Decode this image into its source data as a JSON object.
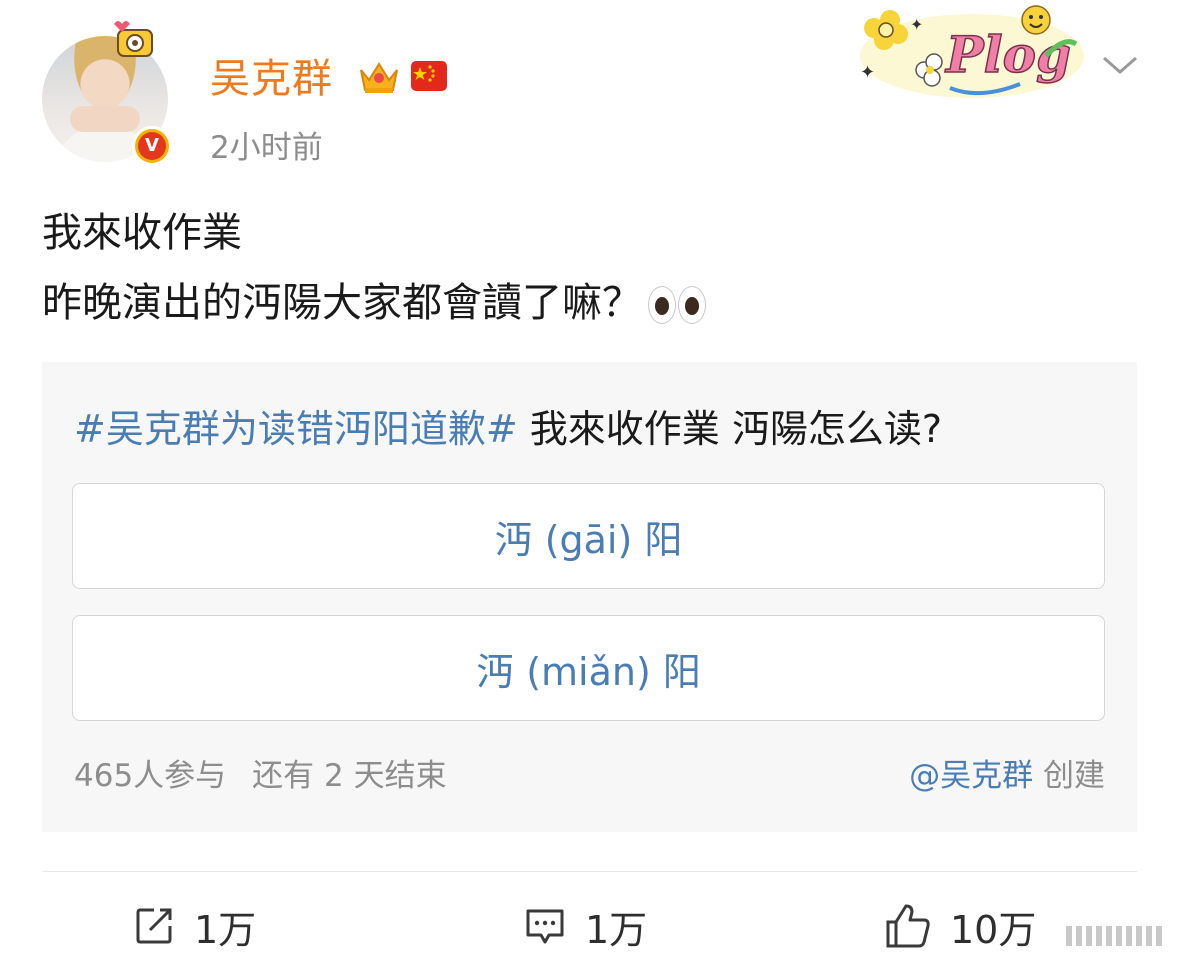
{
  "post": {
    "author": "吴克群",
    "timestamp": "2小时前",
    "lines": [
      "我來收作業",
      "昨晚演出的沔陽大家都會讀了嘛？"
    ],
    "sticker": "Plog"
  },
  "poll": {
    "topic": "#吴克群为读错沔阳道歉#",
    "question": " 我來收作業 沔陽怎么读?",
    "options": [
      "沔 (gāi) 阳",
      "沔 (miǎn) 阳"
    ],
    "participants": "465人参与",
    "remaining": "还有 2 天结束",
    "creator_mention": "@吴克群",
    "creator_suffix": " 创建"
  },
  "actions": {
    "repost_count": "1万",
    "comment_count": "1万",
    "like_count": "10万"
  },
  "icons": [
    "badge-v-icon",
    "crown-icon",
    "china-flag-icon",
    "chevron-down-icon",
    "eyes-emoji-icon",
    "repost-icon",
    "comment-icon",
    "like-icon"
  ],
  "colors": {
    "username": "#ee7a1b",
    "link": "#4a7db3",
    "muted": "#8d8d8d",
    "poll_bg": "#f7f7f7"
  }
}
